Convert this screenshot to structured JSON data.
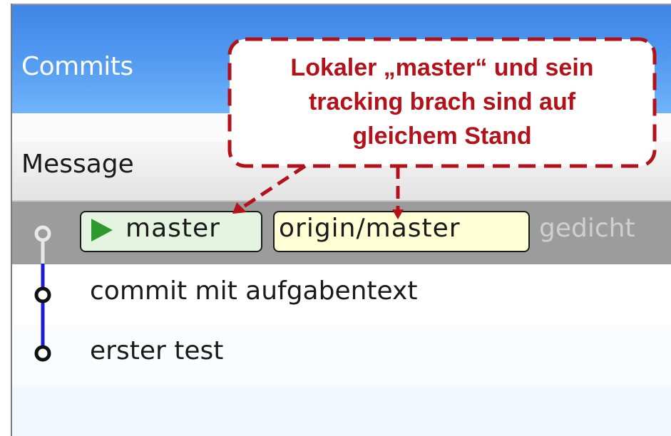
{
  "panel": {
    "title": "Commits"
  },
  "columns": {
    "message": "Message"
  },
  "commits": [
    {
      "branches": [
        {
          "name": "master",
          "kind": "local-head",
          "color": "#e5f4e0",
          "icon": "play-icon"
        },
        {
          "name": "origin/master",
          "kind": "remote-tracking",
          "color": "#ffffd6"
        }
      ],
      "message": "gedicht"
    },
    {
      "message": "commit mit aufgabentext"
    },
    {
      "message": "erster test"
    }
  ],
  "callout": {
    "lines": [
      "Lokaler „master“ und sein",
      "tracking brach sind auf",
      "gleichem Stand"
    ],
    "color": "#b3121b"
  },
  "colors": {
    "header_blue": "#4f97f0",
    "graph_line": "#1c1cd6",
    "selected_row": "#9c9c9c"
  }
}
